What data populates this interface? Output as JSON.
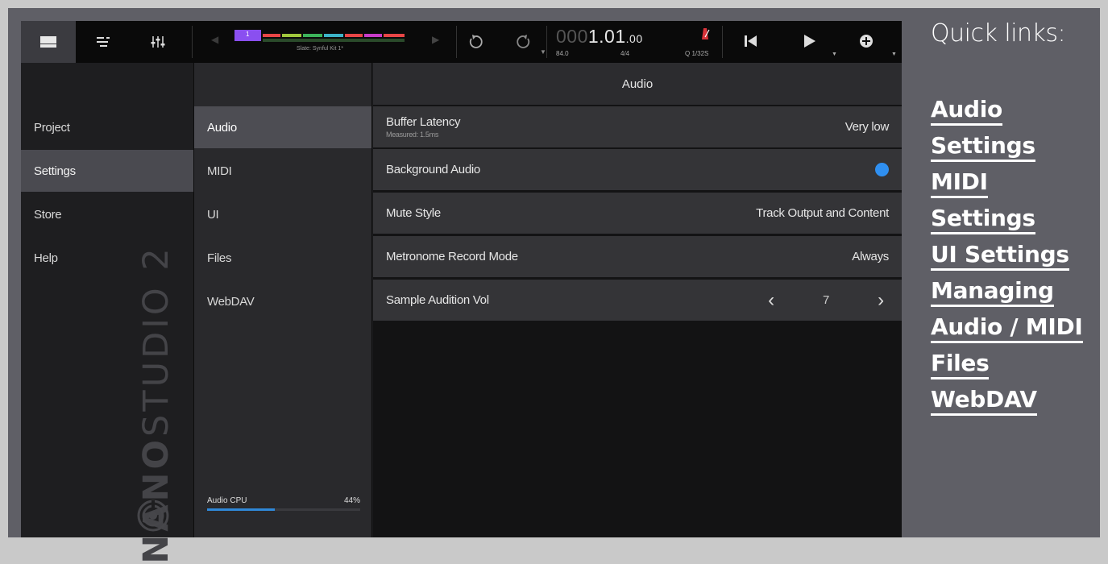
{
  "app": {
    "topbar": {
      "modes": [
        {
          "icon": "clip-launcher-icon",
          "active": true
        },
        {
          "icon": "sequencer-icon",
          "active": false
        },
        {
          "icon": "mixer-icon",
          "active": false
        }
      ],
      "clip_number": "1",
      "clip_name": "Slate: Synful Kit 1*",
      "clip_colors": [
        "#e0b020",
        "#e84646",
        "#a0c83c",
        "#3cb45a",
        "#3cb4c8",
        "#5a7ae8",
        "#e84646",
        "#c83cc8",
        "#e84646"
      ],
      "counter": {
        "dim": "000",
        "main": "1.01",
        "small": ".00"
      },
      "tempo": "84.0",
      "time_sig": "4/4",
      "quantize": "Q 1/32S"
    },
    "nav": {
      "items": [
        {
          "label": "Project",
          "selected": false
        },
        {
          "label": "Settings",
          "selected": true
        },
        {
          "label": "Store",
          "selected": false
        },
        {
          "label": "Help",
          "selected": false
        }
      ],
      "brand": {
        "bold": "NANO",
        "light": "STUDIO 2"
      }
    },
    "subnav": {
      "items": [
        {
          "label": "Audio",
          "selected": true
        },
        {
          "label": "MIDI",
          "selected": false
        },
        {
          "label": "UI",
          "selected": false
        },
        {
          "label": "Files",
          "selected": false
        },
        {
          "label": "WebDAV",
          "selected": false
        }
      ],
      "cpu": {
        "label": "Audio CPU",
        "value": "44%",
        "fraction": 0.44
      }
    },
    "panel": {
      "title": "Audio",
      "rows": [
        {
          "label": "Buffer Latency",
          "sub": "Measured: 1.5ms",
          "value": "Very low"
        },
        {
          "label": "Background Audio",
          "toggle": true,
          "toggle_color": "#2f8ff0"
        },
        {
          "label": "Mute Style",
          "value": "Track Output and Content"
        },
        {
          "label": "Metronome Record Mode",
          "value": "Always"
        },
        {
          "label": "Sample Audition Vol",
          "stepper_value": "7"
        }
      ]
    }
  },
  "quick_links": {
    "title": "Quick links:",
    "links": [
      [
        "Audio",
        "Settings"
      ],
      [
        "MIDI",
        "Settings"
      ],
      [
        "UI Settings"
      ],
      [
        "Managing",
        "Audio / MIDI",
        "Files"
      ],
      [
        "WebDAV"
      ]
    ]
  }
}
